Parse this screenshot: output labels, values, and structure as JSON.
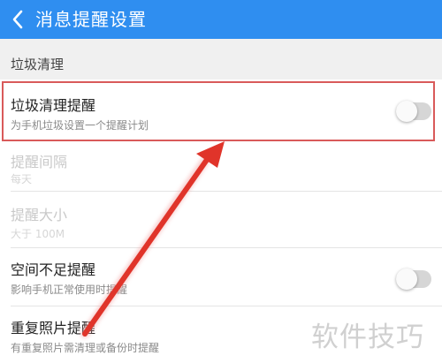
{
  "header": {
    "title": "消息提醒设置",
    "back_icon": "chevron-left-icon"
  },
  "section": {
    "title": "垃圾清理"
  },
  "items": [
    {
      "title": "垃圾清理提醒",
      "subtitle": "为手机垃圾设置一个提醒计划",
      "toggle": false,
      "highlighted": true
    },
    {
      "title": "提醒间隔",
      "subtitle": "每天",
      "disabled": true
    },
    {
      "title": "提醒大小",
      "subtitle": "大于 100M",
      "disabled": true
    },
    {
      "title": "空间不足提醒",
      "subtitle": "影响手机正常使用时提醒",
      "toggle": false
    },
    {
      "title": "重复照片提醒",
      "subtitle": "有重复照片需清理或备份时提醒"
    }
  ],
  "watermark": "软件技巧",
  "colors": {
    "header_bg": "#2f8ef0",
    "highlight_border": "#d95a5a",
    "arrow": "#e0342a",
    "toggle_off": "#d6d6d6"
  }
}
